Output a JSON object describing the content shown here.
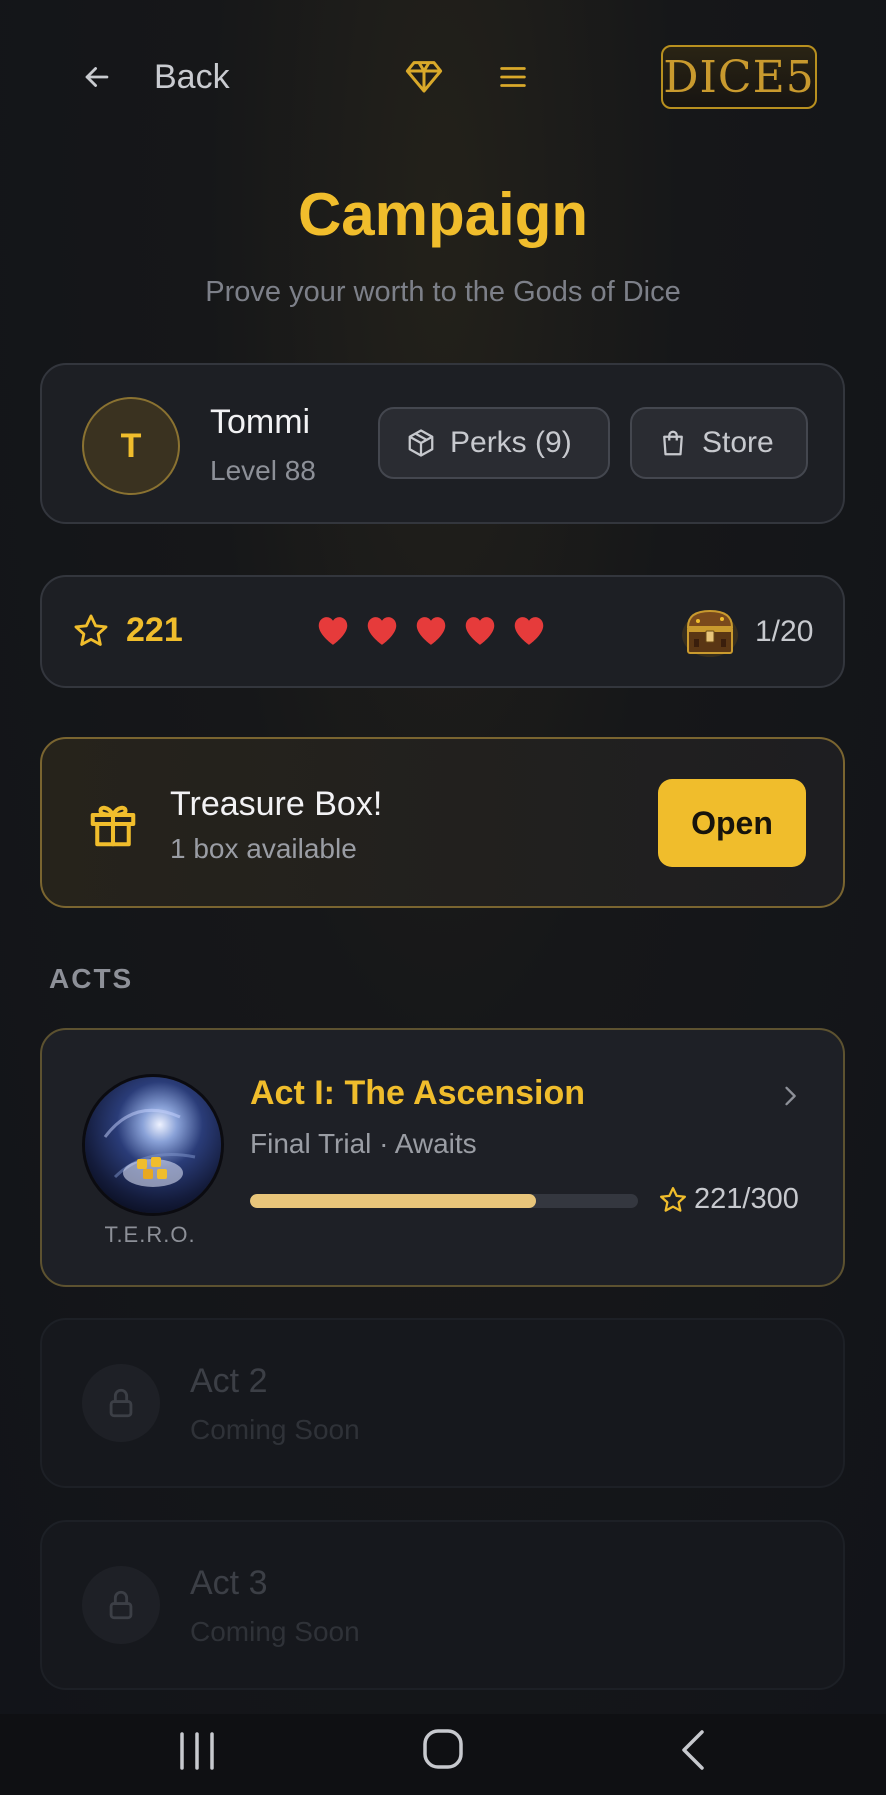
{
  "header": {
    "back_label": "Back",
    "logo_text": "DICE",
    "logo_num": "5"
  },
  "page": {
    "title": "Campaign",
    "subtitle": "Prove your worth to the Gods of Dice"
  },
  "profile": {
    "avatar_initial": "T",
    "name": "Tommi",
    "level": "Level 88",
    "perks_label": "Perks (9)",
    "store_label": "Store"
  },
  "stats": {
    "stars": "221",
    "hearts": 5,
    "chests": "1/20"
  },
  "treasure": {
    "title": "Treasure Box!",
    "subtitle": "1 box available",
    "open_label": "Open"
  },
  "acts": {
    "section_label": "ACTS",
    "items": [
      {
        "title": "Act I: The Ascension",
        "subtitle": "Final Trial · Awaits",
        "image_caption": "T.E.R.O.",
        "score": "221/300",
        "progress": 0.737
      },
      {
        "title": "Act 2",
        "subtitle": "Coming Soon"
      },
      {
        "title": "Act 3",
        "subtitle": "Coming Soon"
      }
    ]
  },
  "colors": {
    "accent": "#f0bd2c",
    "heart": "#e63b3b",
    "progress": "#e8c57a"
  }
}
